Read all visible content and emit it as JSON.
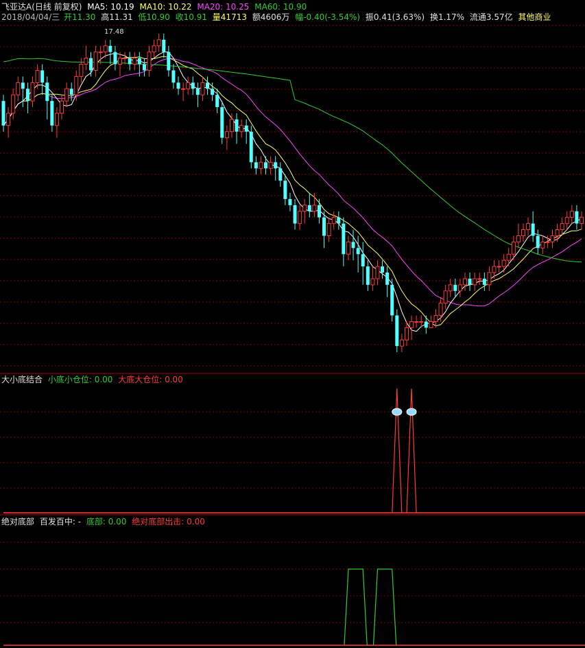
{
  "header": {
    "title": "飞亚达A(日线 前复权)",
    "ma5": "MA5: 10.19",
    "ma10": "MA10: 10.22",
    "ma20": "MA20: 10.25",
    "ma60": "MA60: 10.90"
  },
  "quote": {
    "date": "2018/04/04/三",
    "open": "开11.30",
    "high": "高11.31",
    "low": "低10.90",
    "close": "收10.91",
    "volume": "量41713",
    "amount": "额4606万",
    "change": "幅-0.40(-3.54%)",
    "amplitude": "振0.41(3.63%)",
    "turnover": "换1.17%",
    "float_cap": "流通3.57亿",
    "sector": "其他商业"
  },
  "panel2": {
    "name": "大小底结合",
    "small_label": "小底小仓位: 0.00",
    "big_label": "大底大仓位: 0.00"
  },
  "panel3": {
    "name": "绝对底部",
    "hit_label": "百发百中: -",
    "bottom_label": "底部: 0.00",
    "signal_label": "绝对底部出击: 0.00"
  },
  "colors": {
    "up": "#ff3b3b",
    "down": "#54ffff",
    "ma5": "#ffffff",
    "ma10": "#ffff66",
    "ma20": "#ff44ff",
    "ma60": "#33cc33",
    "grid": "#8b0000",
    "panel_border": "#b00000"
  },
  "chart_data": [
    {
      "type": "candlestick",
      "price_range": [
        9.2,
        12.5
      ],
      "max_label": "17.48",
      "candles": [
        [
          11.6,
          11.2,
          11.7,
          11.1
        ],
        [
          11.2,
          11.4,
          11.5,
          11.0
        ],
        [
          11.4,
          11.7,
          11.8,
          11.3
        ],
        [
          11.7,
          11.9,
          12.0,
          11.6
        ],
        [
          11.9,
          11.8,
          12.0,
          11.5
        ],
        [
          11.8,
          11.6,
          11.9,
          11.4
        ],
        [
          11.6,
          11.9,
          12.0,
          11.5
        ],
        [
          11.9,
          12.1,
          12.2,
          11.8
        ],
        [
          12.1,
          11.9,
          12.2,
          11.7
        ],
        [
          11.9,
          11.6,
          12.0,
          11.3
        ],
        [
          11.6,
          11.2,
          11.7,
          11.1
        ],
        [
          11.2,
          11.4,
          11.5,
          11.0
        ],
        [
          11.4,
          11.6,
          11.7,
          11.3
        ],
        [
          11.6,
          11.8,
          11.9,
          11.5
        ],
        [
          11.8,
          11.7,
          11.9,
          11.6
        ],
        [
          11.7,
          12.0,
          12.1,
          11.6
        ],
        [
          12.0,
          12.2,
          12.3,
          11.9
        ],
        [
          12.2,
          12.3,
          12.5,
          12.1
        ],
        [
          12.3,
          12.1,
          12.4,
          12.0
        ],
        [
          12.1,
          12.4,
          12.5,
          12.0
        ],
        [
          12.4,
          12.4,
          12.5,
          12.2
        ],
        [
          12.4,
          12.5,
          12.6,
          12.3
        ],
        [
          12.5,
          12.4,
          12.6,
          12.2
        ],
        [
          12.4,
          12.2,
          12.5,
          12.1
        ],
        [
          12.2,
          12.3,
          12.4,
          12.0
        ],
        [
          12.3,
          12.3,
          12.4,
          12.2
        ],
        [
          12.3,
          12.2,
          12.4,
          12.1
        ],
        [
          12.2,
          12.3,
          12.4,
          12.1
        ],
        [
          12.3,
          12.2,
          12.4,
          12.0
        ],
        [
          12.2,
          12.1,
          12.3,
          12.0
        ],
        [
          12.1,
          12.4,
          12.5,
          12.0
        ],
        [
          12.4,
          12.5,
          12.6,
          12.3
        ],
        [
          12.5,
          12.6,
          12.7,
          12.4
        ],
        [
          12.6,
          12.4,
          12.7,
          12.3
        ],
        [
          12.4,
          12.1,
          12.5,
          12.0
        ],
        [
          12.1,
          11.9,
          12.2,
          11.8
        ],
        [
          11.9,
          11.8,
          12.0,
          11.7
        ],
        [
          11.8,
          11.8,
          11.9,
          11.6
        ],
        [
          11.8,
          11.9,
          12.0,
          11.7
        ],
        [
          11.9,
          11.8,
          12.0,
          11.7
        ],
        [
          11.8,
          11.7,
          11.9,
          11.5
        ],
        [
          11.7,
          11.9,
          12.0,
          11.6
        ],
        [
          11.9,
          11.8,
          12.0,
          11.7
        ],
        [
          11.8,
          11.7,
          11.9,
          11.6
        ],
        [
          11.7,
          11.5,
          11.8,
          11.4
        ],
        [
          11.5,
          11.0,
          11.6,
          10.9
        ],
        [
          11.0,
          11.1,
          11.2,
          10.8
        ],
        [
          11.1,
          11.3,
          11.4,
          11.0
        ],
        [
          11.3,
          11.1,
          11.4,
          10.9
        ],
        [
          11.1,
          11.2,
          11.3,
          11.0
        ],
        [
          11.2,
          11.1,
          11.3,
          10.9
        ],
        [
          11.1,
          10.6,
          11.2,
          10.5
        ],
        [
          10.6,
          10.5,
          10.7,
          10.4
        ],
        [
          10.5,
          10.6,
          10.7,
          10.4
        ],
        [
          10.6,
          10.5,
          10.7,
          10.4
        ],
        [
          10.5,
          10.6,
          10.7,
          10.4
        ],
        [
          10.6,
          10.5,
          10.7,
          10.3
        ],
        [
          10.5,
          10.3,
          10.6,
          10.2
        ],
        [
          10.3,
          10.0,
          10.4,
          9.9
        ],
        [
          10.0,
          9.9,
          10.1,
          9.8
        ],
        [
          9.9,
          9.6,
          10.0,
          9.5
        ],
        [
          9.6,
          9.8,
          9.9,
          9.5
        ],
        [
          9.8,
          9.9,
          10.0,
          9.6
        ],
        [
          9.9,
          9.8,
          10.1,
          9.7
        ],
        [
          9.8,
          9.9,
          10.1,
          9.7
        ],
        [
          9.9,
          9.7,
          10.0,
          9.6
        ],
        [
          9.7,
          9.4,
          9.8,
          9.2
        ],
        [
          9.4,
          9.6,
          9.7,
          9.3
        ],
        [
          9.6,
          9.7,
          9.8,
          9.5
        ],
        [
          9.7,
          9.6,
          9.8,
          9.5
        ],
        [
          9.6,
          9.1,
          9.7,
          8.9
        ],
        [
          9.1,
          9.3,
          9.4,
          9.0
        ],
        [
          9.3,
          9.2,
          9.5,
          9.0
        ],
        [
          9.2,
          9.1,
          9.4,
          8.8
        ],
        [
          9.1,
          8.9,
          9.3,
          8.6
        ],
        [
          8.9,
          8.6,
          9.0,
          8.5
        ],
        [
          8.6,
          8.7,
          8.9,
          8.5
        ],
        [
          8.7,
          8.9,
          9.0,
          8.6
        ],
        [
          8.9,
          8.8,
          9.0,
          8.7
        ],
        [
          8.8,
          8.6,
          8.9,
          8.4
        ],
        [
          8.6,
          8.1,
          8.7,
          8.0
        ],
        [
          8.1,
          7.6,
          8.2,
          7.5
        ],
        [
          7.6,
          7.7,
          7.8,
          7.5
        ],
        [
          7.7,
          7.9,
          8.0,
          7.6
        ],
        [
          7.9,
          8.0,
          8.1,
          7.7
        ],
        [
          8.0,
          8.0,
          8.1,
          7.9
        ],
        [
          8.0,
          8.0,
          8.1,
          7.9
        ],
        [
          8.0,
          7.9,
          8.1,
          7.8
        ],
        [
          7.9,
          8.0,
          8.1,
          7.9
        ],
        [
          8.0,
          8.1,
          8.2,
          7.9
        ],
        [
          8.1,
          8.3,
          8.4,
          8.0
        ],
        [
          8.3,
          8.5,
          8.6,
          8.2
        ],
        [
          8.5,
          8.6,
          8.7,
          8.4
        ],
        [
          8.6,
          8.5,
          8.7,
          8.4
        ],
        [
          8.5,
          8.6,
          8.7,
          8.4
        ],
        [
          8.6,
          8.7,
          8.8,
          8.5
        ],
        [
          8.7,
          8.6,
          8.8,
          8.5
        ],
        [
          8.6,
          8.7,
          8.8,
          8.5
        ],
        [
          8.7,
          8.7,
          8.8,
          8.6
        ],
        [
          8.7,
          8.6,
          8.8,
          8.5
        ],
        [
          8.6,
          8.8,
          8.9,
          8.5
        ],
        [
          8.8,
          8.9,
          9.0,
          8.7
        ],
        [
          8.9,
          8.9,
          9.0,
          8.8
        ],
        [
          8.9,
          9.0,
          9.1,
          8.8
        ],
        [
          9.0,
          9.1,
          9.2,
          8.9
        ],
        [
          9.1,
          9.3,
          9.4,
          9.0
        ],
        [
          9.3,
          9.4,
          9.6,
          9.2
        ],
        [
          9.4,
          9.5,
          9.6,
          9.3
        ],
        [
          9.5,
          9.6,
          9.7,
          9.4
        ],
        [
          9.6,
          9.4,
          9.8,
          9.3
        ],
        [
          9.4,
          9.2,
          9.5,
          9.1
        ],
        [
          9.2,
          9.3,
          9.4,
          9.1
        ],
        [
          9.3,
          9.3,
          9.4,
          9.2
        ],
        [
          9.3,
          9.4,
          9.5,
          9.2
        ],
        [
          9.4,
          9.5,
          9.6,
          9.3
        ],
        [
          9.5,
          9.6,
          9.7,
          9.4
        ],
        [
          9.6,
          9.7,
          9.8,
          9.5
        ],
        [
          9.7,
          9.8,
          9.9,
          9.6
        ],
        [
          9.8,
          9.6,
          9.9,
          9.5
        ],
        [
          9.6,
          9.7,
          9.8,
          9.5
        ]
      ]
    },
    {
      "type": "line",
      "title": "大小底结合",
      "series": [
        {
          "name": "小底小仓位",
          "color": "#33cc33",
          "values": []
        },
        {
          "name": "大底大仓位",
          "color": "#ff3b3b",
          "peaks_at_index": [
            81,
            84
          ]
        }
      ]
    },
    {
      "type": "line",
      "title": "绝对底部",
      "series": [
        {
          "name": "底部",
          "color": "#33cc33",
          "plateaus_index": [
            [
              71,
              74
            ],
            [
              77,
              80
            ]
          ]
        },
        {
          "name": "绝对底部出击",
          "color": "#ff3b3b",
          "values": []
        }
      ]
    }
  ]
}
